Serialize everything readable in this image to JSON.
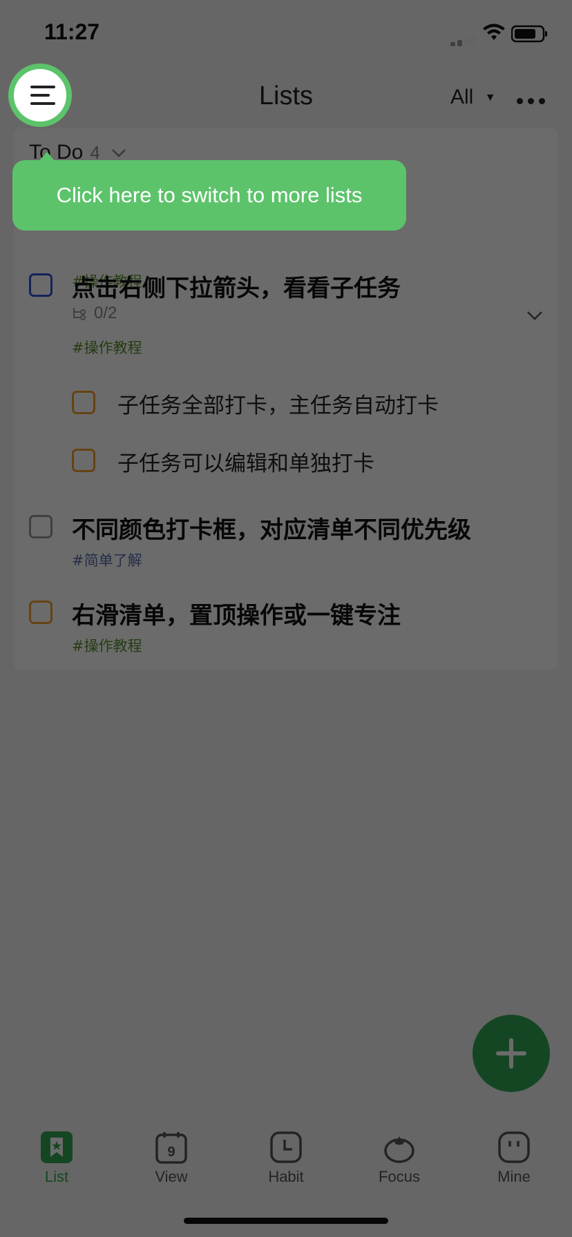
{
  "status_bar": {
    "time": "11:27"
  },
  "header": {
    "title": "Lists",
    "filter_label": "All"
  },
  "tooltip": {
    "text": "Click here to switch to more lists"
  },
  "section": {
    "name": "To Do",
    "count": "4"
  },
  "tasks": [
    {
      "title": "",
      "tag": "#操作教程",
      "checkbox_color": "#f0a030"
    },
    {
      "title": "点击右侧下拉箭头，看看子任务",
      "subtask_progress": "0/2",
      "tag": "#操作教程",
      "checkbox_color": "#2f55d4"
    },
    {
      "title": "不同颜色打卡框，对应清单不同优先级",
      "tag": "#简单了解",
      "checkbox_color": "#999999"
    },
    {
      "title": "右滑清单，置顶操作或一键专注",
      "tag": "#操作教程",
      "checkbox_color": "#f0a030"
    }
  ],
  "subtasks": [
    {
      "title": "子任务全部打卡，主任务自动打卡",
      "checkbox_color": "#f0a030"
    },
    {
      "title": "子任务可以编辑和单独打卡",
      "checkbox_color": "#f0a030"
    }
  ],
  "tabs": [
    {
      "label": "List",
      "icon": "list-icon",
      "active": true
    },
    {
      "label": "View",
      "icon": "calendar-icon",
      "active": false
    },
    {
      "label": "Habit",
      "icon": "clock-icon",
      "active": false
    },
    {
      "label": "Focus",
      "icon": "tomato-icon",
      "active": false
    },
    {
      "label": "Mine",
      "icon": "profile-face-icon",
      "active": false
    }
  ],
  "calendar_icon_day": "9",
  "colors": {
    "accent": "#34a853",
    "highlight": "#5cc36b"
  }
}
